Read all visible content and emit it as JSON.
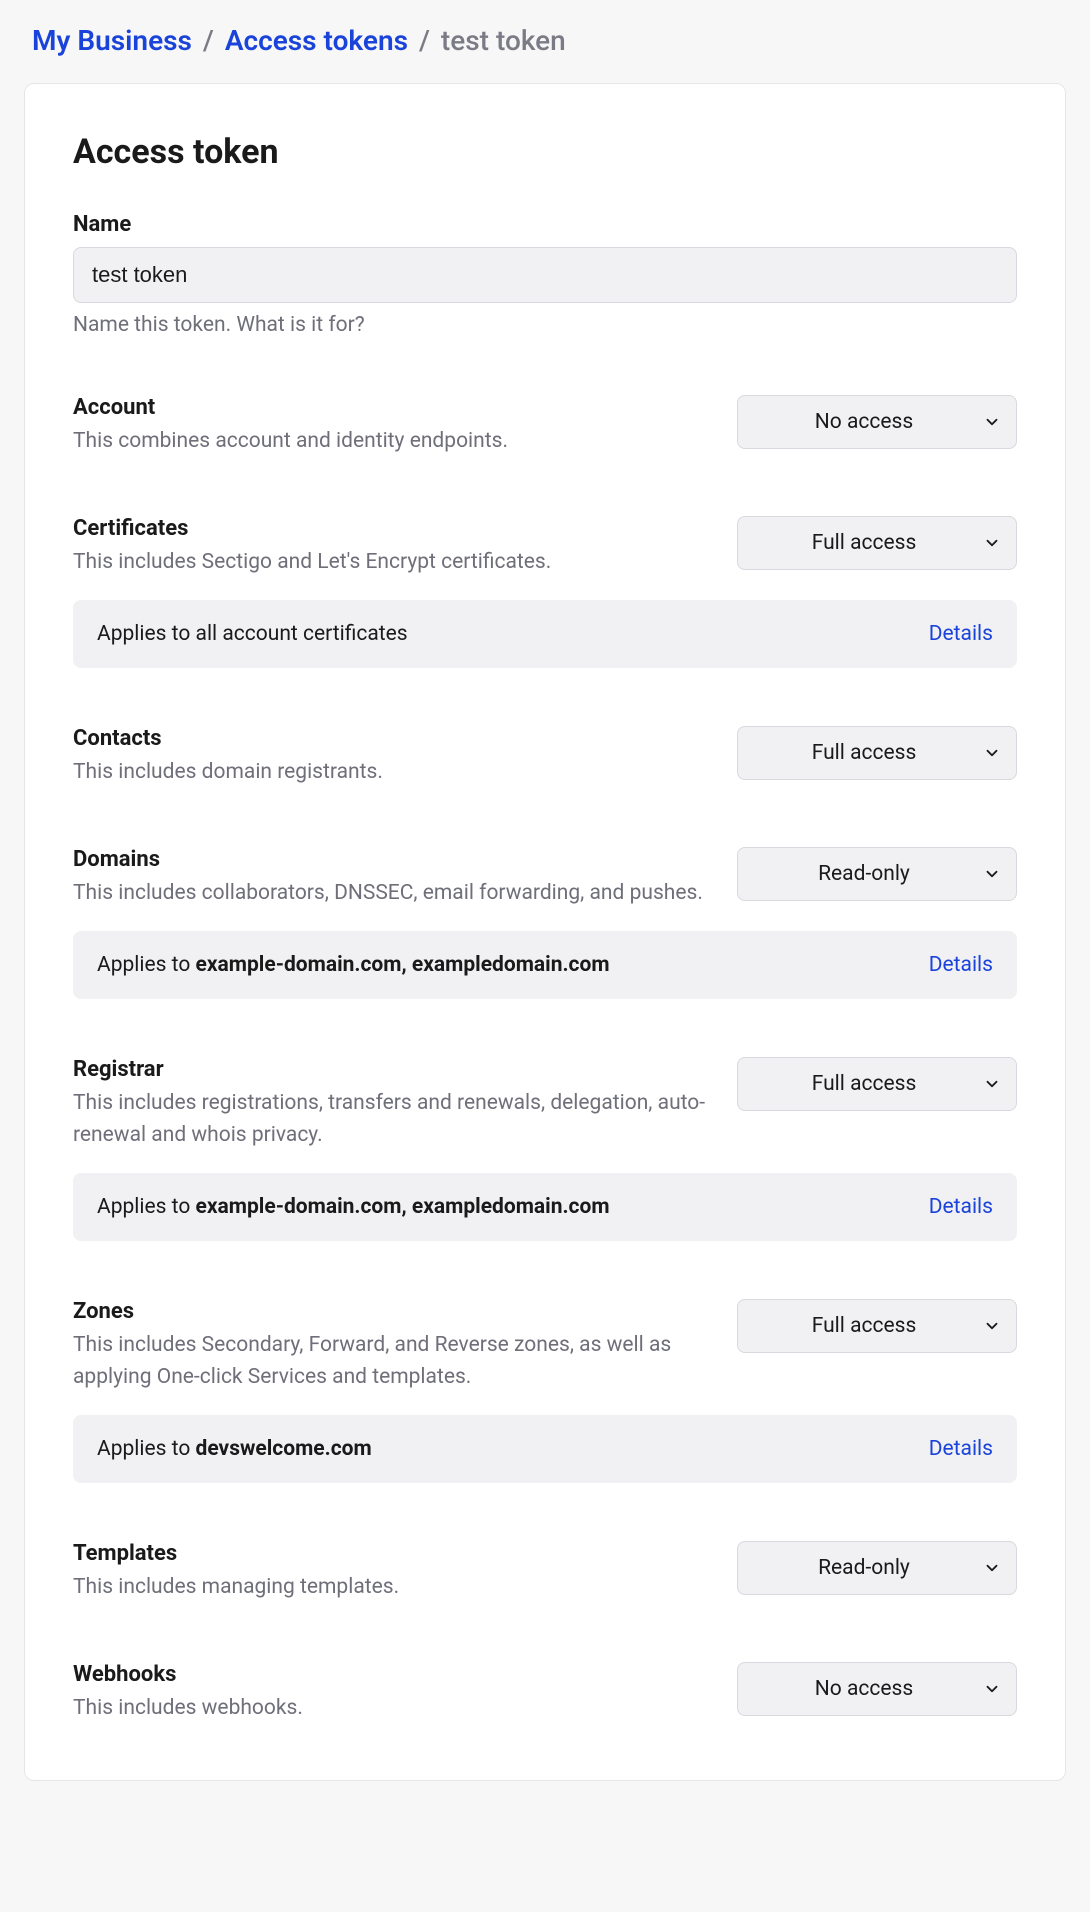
{
  "breadcrumbs": {
    "root": "My Business",
    "level1": "Access tokens",
    "current": "test token"
  },
  "page_title": "Access token",
  "name": {
    "label": "Name",
    "value": "test token",
    "help": "Name this token. What is it for?"
  },
  "details_label": "Details",
  "applies_prefix": "Applies to ",
  "sections": {
    "account": {
      "title": "Account",
      "desc": "This combines account and identity endpoints.",
      "value": "No access"
    },
    "certificates": {
      "title": "Certificates",
      "desc": "This includes Sectigo and Let's Encrypt certificates.",
      "value": "Full access",
      "applies": "all account certificates"
    },
    "contacts": {
      "title": "Contacts",
      "desc": "This includes domain registrants.",
      "value": "Full access"
    },
    "domains": {
      "title": "Domains",
      "desc": "This includes collaborators, DNSSEC, email forwarding, and pushes.",
      "value": "Read-only",
      "applies": "example-domain.com, exampledomain.com"
    },
    "registrar": {
      "title": "Registrar",
      "desc": "This includes registrations, transfers and renewals, delegation, auto-renewal and whois privacy.",
      "value": "Full access",
      "applies": "example-domain.com, exampledomain.com"
    },
    "zones": {
      "title": "Zones",
      "desc": "This includes Secondary, Forward, and Reverse zones, as well as applying One-click Services and templates.",
      "value": "Full access",
      "applies": "devswelcome.com"
    },
    "templates": {
      "title": "Templates",
      "desc": "This includes managing templates.",
      "value": "Read-only"
    },
    "webhooks": {
      "title": "Webhooks",
      "desc": "This includes webhooks.",
      "value": "No access"
    }
  }
}
